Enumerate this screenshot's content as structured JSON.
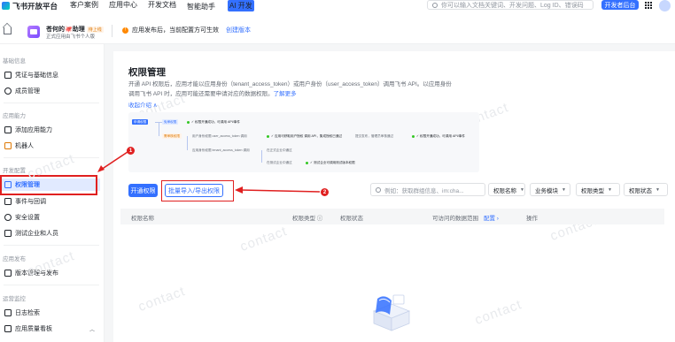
{
  "topnav": {
    "brand": "飞书开放平台",
    "links": [
      "客户案例",
      "应用中心",
      "开发文档",
      "智能助手"
    ],
    "ai_badge": "AI 开发",
    "search_placeholder": "你可以输入文档关键词、开发问题、Log ID、错误码",
    "dev_console": "开发者后台"
  },
  "app": {
    "name": "苍何的🐙助理",
    "status": "待上线",
    "subtitle": "正式应用由飞书个人版",
    "notice": "应用发布后，当前配置方可生效",
    "notice_link": "创建版本"
  },
  "sidebar": {
    "sections": [
      {
        "title": "基础信息",
        "items": [
          "凭证与基础信息",
          "成员管理"
        ]
      },
      {
        "title": "应用能力",
        "items": [
          "添加应用能力",
          "机器人"
        ]
      },
      {
        "title": "开发配置",
        "items": [
          "权限管理",
          "事件与回调",
          "安全设置",
          "测试企业和人员"
        ]
      },
      {
        "title": "应用发布",
        "items": [
          "版本管理与发布"
        ]
      },
      {
        "title": "运营监控",
        "items": [
          "日志检索",
          "应用质量看板"
        ]
      }
    ],
    "active": "权限管理"
  },
  "main": {
    "title": "权限管理",
    "desc_1": "开通 API 权限后，应用才能以应用身份（tenant_access_token）或用户身份（user_access_token）调用飞书 API。以应用身份",
    "desc_2": "调用飞书 API 时，应用可能还需要申请对应的数据权限。",
    "desc_link": "了解更多",
    "collapse": "收起介绍 ∧",
    "flow": {
      "n1": "申请权限",
      "n2": "免审权限",
      "n3": "✓ 权限开通成功，可调用 API/事件",
      "n4": "需审核权限",
      "n5": "用户身份权限 user_access_token 调用",
      "n6": "✓ 应用可获取用户授权 调用 API，集成授权已通过",
      "n7": "提交发布，管理员审核通过",
      "n8": "✓ 权限开通成功，可调用 API/事件",
      "n9": "应用身份权限 tenant_access_token 调用",
      "n10": "在正式企业中通过",
      "n11": "在测试企业中通过",
      "n12": "✓ 测试企业可调用测试版本权限"
    },
    "btn_enable": "开通权限",
    "btn_batch": "批量导入/导出权限",
    "search_placeholder": "例如：获取群组信息、im:cha...",
    "filters": [
      "权限名称",
      "业务模块",
      "权限类型",
      "权限状态"
    ],
    "columns": [
      "权限名称",
      "权限类型 ⓘ",
      "权限状态",
      "可访问的数据范围",
      "配置 ›",
      "操作"
    ],
    "watermark": "contact"
  },
  "annotations": [
    "1",
    "2"
  ],
  "colors": {
    "accent": "#3370ff",
    "annotation": "#e02020",
    "warning": "#ff8800"
  }
}
